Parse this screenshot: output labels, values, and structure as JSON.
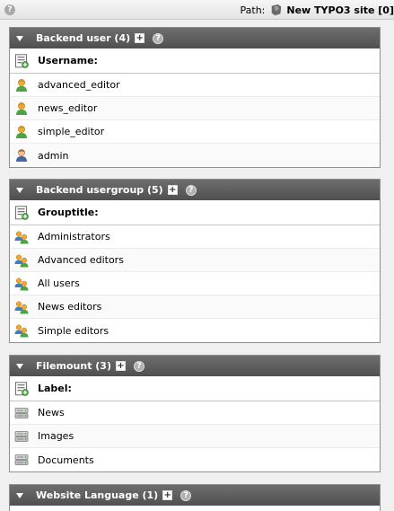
{
  "topbar": {
    "help": "?",
    "path_label": "Path:",
    "site_title": "New TYPO3 site [0]"
  },
  "panels": [
    {
      "title": "Backend user (4)",
      "column": "Username:",
      "rows": [
        {
          "label": "advanced_editor",
          "icon": "user-icon"
        },
        {
          "label": "news_editor",
          "icon": "user-icon"
        },
        {
          "label": "simple_editor",
          "icon": "user-icon"
        },
        {
          "label": "admin",
          "icon": "admin-user-icon"
        }
      ]
    },
    {
      "title": "Backend usergroup (5)",
      "column": "Grouptitle:",
      "rows": [
        {
          "label": "Administrators",
          "icon": "usergroup-icon"
        },
        {
          "label": "Advanced editors",
          "icon": "usergroup-icon"
        },
        {
          "label": "All users",
          "icon": "usergroup-icon"
        },
        {
          "label": "News editors",
          "icon": "usergroup-icon"
        },
        {
          "label": "Simple editors",
          "icon": "usergroup-icon"
        }
      ]
    },
    {
      "title": "Filemount (3)",
      "column": "Label:",
      "rows": [
        {
          "label": "News",
          "icon": "filemount-icon"
        },
        {
          "label": "Images",
          "icon": "filemount-icon"
        },
        {
          "label": "Documents",
          "icon": "filemount-icon"
        }
      ]
    },
    {
      "title": "Website Language (1)"
    }
  ],
  "colors": {
    "header_bg": "#5a5a5a",
    "page_bg": "#f0f0f0",
    "user_orange": "#e8a12a",
    "user_green": "#3f9b3a",
    "admin_blue": "#3d6fa8"
  }
}
